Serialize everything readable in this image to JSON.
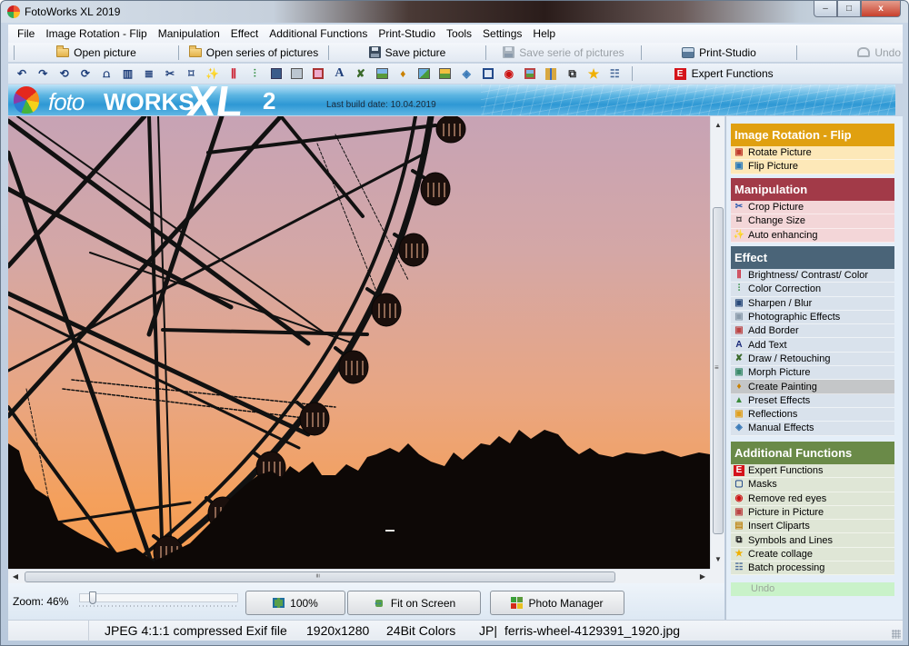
{
  "window": {
    "title": "FotoWorks XL 2019",
    "controls": {
      "minimize": "–",
      "maximize": "□",
      "close": "x"
    }
  },
  "menu": [
    "File",
    "Image Rotation - Flip",
    "Manipulation",
    "Effect",
    "Additional Functions",
    "Print-Studio",
    "Tools",
    "Settings",
    "Help"
  ],
  "toolbar": {
    "open_picture": "Open picture",
    "open_series": "Open series of pictures",
    "save_picture": "Save picture",
    "save_series": "Save serie of pictures",
    "print_studio": "Print-Studio",
    "undo": "Undo"
  },
  "icon_toolbar": {
    "icons": [
      "rotate-left-icon",
      "rotate-right-icon",
      "rotate-ccw-icon",
      "rotate-cw-icon",
      "flip-icon",
      "mirror-icon",
      "resize-icon",
      "crop-icon",
      "change-size-icon",
      "auto-enhance-icon",
      "brightness-icon",
      "color-correction-icon",
      "sharpen-icon",
      "photo-effects-icon",
      "border-icon",
      "text-icon",
      "draw-icon",
      "morph-icon",
      "painting-icon",
      "preset-effects-icon",
      "reflections-icon",
      "manual-effects-icon",
      "mask-icon",
      "red-eye-icon",
      "picture-in-picture-icon",
      "clipart-icon",
      "symbols-icon",
      "collage-icon",
      "batch-icon"
    ],
    "expert_label": "Expert Functions"
  },
  "banner": {
    "logo_foto": "foto",
    "logo_works": "WORKS",
    "logo_xl": "XL",
    "logo_version": "2",
    "build_date": "Last build date: 10.04.2019"
  },
  "controls": {
    "zoom_label": "Zoom: 46%",
    "zoom_percent": 46,
    "zoom_slider_fraction": 0.03,
    "btn_100": "100%",
    "btn_fit": "Fit on Screen",
    "btn_photo_manager": "Photo Manager"
  },
  "panel": {
    "sections": [
      {
        "title": "Image Rotation - Flip",
        "header_color": "#e0a010",
        "item_bg": "#fde8b8",
        "items": [
          {
            "label": "Rotate Picture",
            "icon": "rotate-picture-icon"
          },
          {
            "label": "Flip Picture",
            "icon": "flip-picture-icon"
          }
        ]
      },
      {
        "title": "Manipulation",
        "header_color": "#a23a48",
        "item_bg": "#f3d6d8",
        "items": [
          {
            "label": "Crop Picture",
            "icon": "crop-icon"
          },
          {
            "label": "Change Size",
            "icon": "change-size-icon"
          },
          {
            "label": "Auto enhancing",
            "icon": "auto-enhance-icon"
          }
        ]
      },
      {
        "title": "Effect",
        "header_color": "#4a6478",
        "item_bg": "#d9e2ec",
        "items": [
          {
            "label": "Brightness/ Contrast/ Color",
            "icon": "brightness-icon"
          },
          {
            "label": "Color Correction",
            "icon": "color-correction-icon"
          },
          {
            "label": "Sharpen / Blur",
            "icon": "sharpen-icon"
          },
          {
            "label": "Photographic Effects",
            "icon": "photo-effects-icon"
          },
          {
            "label": "Add Border",
            "icon": "border-icon"
          },
          {
            "label": "Add Text",
            "icon": "text-icon"
          },
          {
            "label": "Draw / Retouching",
            "icon": "draw-icon"
          },
          {
            "label": "Morph Picture",
            "icon": "morph-icon"
          },
          {
            "label": "Create Painting",
            "icon": "painting-icon",
            "selected": true
          },
          {
            "label": "Preset Effects",
            "icon": "preset-effects-icon"
          },
          {
            "label": "Reflections",
            "icon": "reflections-icon"
          },
          {
            "label": "Manual Effects",
            "icon": "manual-effects-icon"
          }
        ]
      },
      {
        "title": "Additional Functions",
        "header_color": "#6a8a48",
        "item_bg": "#dfe6d6",
        "items": [
          {
            "label": "Expert Functions",
            "icon": "expert-icon"
          },
          {
            "label": "Masks",
            "icon": "mask-icon"
          },
          {
            "label": "Remove red eyes",
            "icon": "red-eye-icon"
          },
          {
            "label": "Picture in Picture",
            "icon": "picture-in-picture-icon"
          },
          {
            "label": "Insert Cliparts",
            "icon": "clipart-icon"
          },
          {
            "label": "Symbols and Lines",
            "icon": "symbols-icon"
          },
          {
            "label": "Create collage",
            "icon": "collage-icon"
          },
          {
            "label": "Batch processing",
            "icon": "batch-icon"
          }
        ]
      }
    ],
    "undo_label": "Undo"
  },
  "status": {
    "format": "JPEG 4:1:1 compressed Exif file",
    "dimensions": "1920x1280",
    "colors": "24Bit Colors",
    "ext": "JP|",
    "filename": "ferris-wheel-4129391_1920.jpg"
  }
}
